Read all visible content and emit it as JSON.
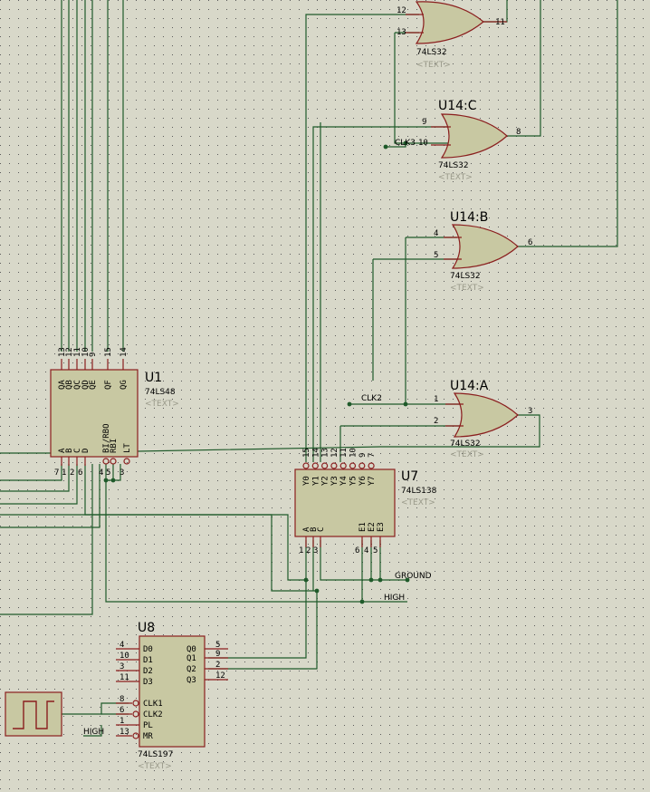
{
  "colors": {
    "background": "#d8d8c9",
    "wire": "#1f5a2a",
    "component_border": "#8a1e1e",
    "component_fill": "#c8c8a2"
  },
  "gates": [
    {
      "id": "u14d",
      "ref": "",
      "part": "74LS32",
      "text": "<TEXT>",
      "in_pins": [
        "12",
        "13"
      ],
      "out_pin": "11"
    },
    {
      "id": "u14c",
      "ref": "U14:C",
      "part": "74LS32",
      "text": "<TEXT>",
      "in_pins": [
        "9",
        "10"
      ],
      "out_pin": "8"
    },
    {
      "id": "u14b",
      "ref": "U14:B",
      "part": "74LS32",
      "text": "<TEXT>",
      "in_pins": [
        "4",
        "5"
      ],
      "out_pin": "6"
    },
    {
      "id": "u14a",
      "ref": "U14:A",
      "part": "74LS32",
      "text": "<TEXT>",
      "in_pins": [
        "1",
        "2"
      ],
      "out_pin": "3"
    }
  ],
  "u1": {
    "ref": "U1",
    "part": "74LS48",
    "text": "<TEXT>",
    "top_pins": [
      "13",
      "12",
      "11",
      "10",
      "9",
      "15",
      "14"
    ],
    "top_names": [
      "QA",
      "QB",
      "QC",
      "QD",
      "QE",
      "QF",
      "QG"
    ],
    "bottom_pins": [
      "7",
      "1",
      "2",
      "6",
      "4",
      "5",
      "3"
    ],
    "bottom_names": [
      "A",
      "B",
      "C",
      "D",
      "BI/RBO",
      "RBI",
      "LT"
    ]
  },
  "u7": {
    "ref": "U7",
    "part": "74LS138",
    "text": "<TEXT>",
    "top_pins": [
      "15",
      "14",
      "13",
      "12",
      "11",
      "10",
      "9",
      "7"
    ],
    "top_names": [
      "Y0",
      "Y1",
      "Y2",
      "Y3",
      "Y4",
      "Y5",
      "Y6",
      "Y7"
    ],
    "bottom_pins": [
      "1",
      "2",
      "3",
      "6",
      "4",
      "5"
    ],
    "bottom_names": [
      "A",
      "B",
      "C",
      "E1",
      "E2",
      "E3"
    ]
  },
  "u8": {
    "ref": "U8",
    "part": "74LS197",
    "text": "<TEXT>",
    "left_pins": [
      "4",
      "10",
      "3",
      "11",
      "8",
      "6",
      "1",
      "13"
    ],
    "left_names": [
      "D0",
      "D1",
      "D2",
      "D3",
      "CLK1",
      "CLK2",
      "PL",
      "MR"
    ],
    "right_pins": [
      "5",
      "9",
      "2",
      "12"
    ],
    "right_names": [
      "Q0",
      "Q1",
      "Q2",
      "Q3"
    ]
  },
  "net_labels": {
    "clk3": "CLK3",
    "clk2": "CLK2",
    "ground": "GROUND",
    "high1": "HIGH",
    "high2": "HIGH"
  }
}
